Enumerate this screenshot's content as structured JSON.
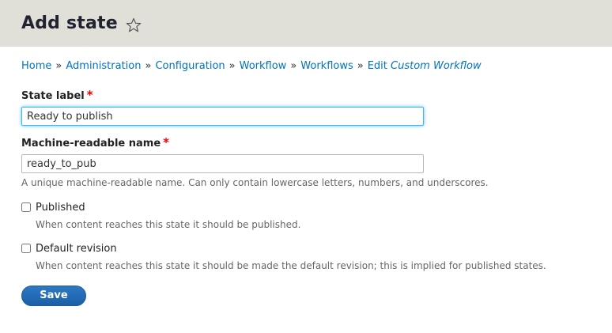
{
  "header": {
    "title": "Add state",
    "star_icon": "star-outline-icon"
  },
  "breadcrumb": {
    "items": [
      {
        "label": "Home"
      },
      {
        "label": "Administration"
      },
      {
        "label": "Configuration"
      },
      {
        "label": "Workflow"
      },
      {
        "label": "Workflows"
      }
    ],
    "edit_prefix": "Edit",
    "edit_name": "Custom Workflow",
    "separator": "»"
  },
  "form": {
    "state_label": {
      "label": "State label",
      "required_mark": "*",
      "value": "Ready to publish"
    },
    "machine_name": {
      "label": "Machine-readable name",
      "required_mark": "*",
      "value": "ready_to_pub",
      "description": "A unique machine-readable name. Can only contain lowercase letters, numbers, and underscores."
    },
    "published": {
      "label": "Published",
      "checked": false,
      "description": "When content reaches this state it should be published."
    },
    "default_revision": {
      "label": "Default revision",
      "checked": false,
      "description": "When content reaches this state it should be made the default revision; this is implied for published states."
    },
    "save_label": "Save"
  },
  "colors": {
    "header_bg": "#e0e0d8",
    "link": "#0074bd",
    "required": "#ee0000",
    "primary_button": "#2368b5",
    "focus_border": "#40b6ff"
  }
}
